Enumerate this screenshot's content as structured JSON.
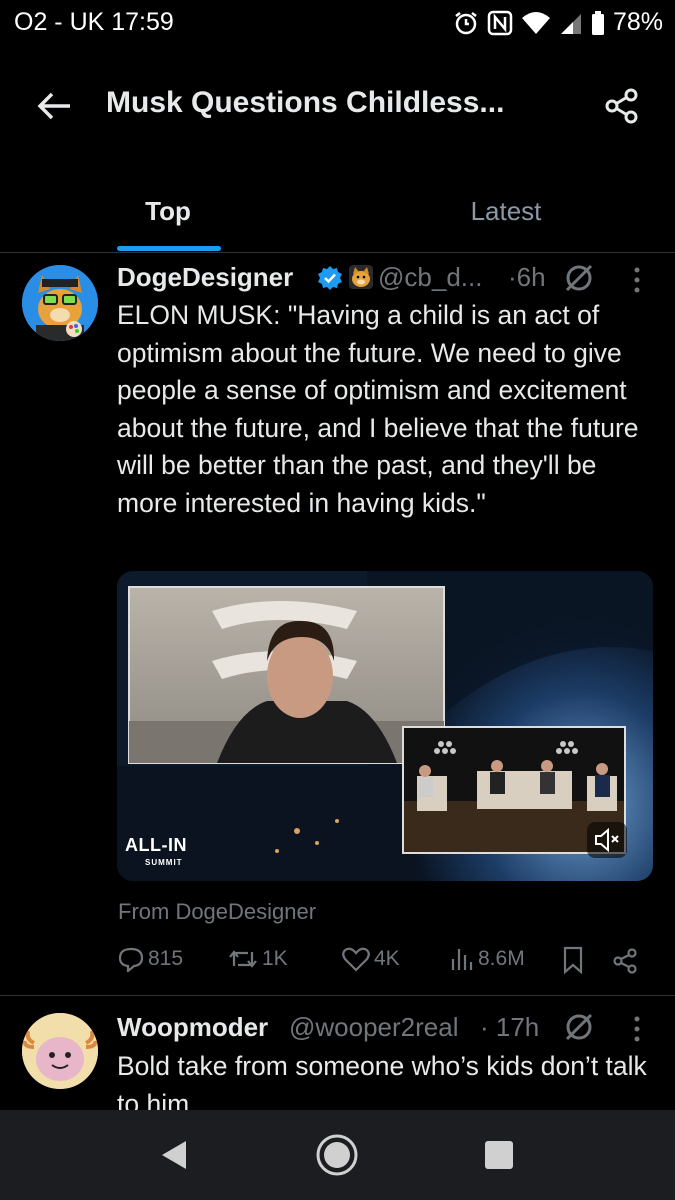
{
  "status_bar": {
    "carrier_time": "O2 - UK 17:59",
    "battery": "78%"
  },
  "header": {
    "title": "Musk Questions Childless...",
    "back_icon": "arrow-left-icon",
    "share_icon": "share-icon"
  },
  "tabs": [
    {
      "label": "Top",
      "active": true
    },
    {
      "label": "Latest",
      "active": false
    }
  ],
  "tweets": [
    {
      "display_name": "DogeDesigner",
      "handle": "@cb_d...",
      "time": "·6h",
      "text": "ELON MUSK: \"Having a child is an act of optimism about the future. We need to give people a sense of optimism and excitement about the future, and I believe that the future will be better than the past, and they'll be more interested in having kids.\"",
      "media": {
        "overlay_title": "ALL-IN",
        "overlay_subtitle": "SUMMIT"
      },
      "from_label": "From DogeDesigner",
      "stats": {
        "replies": "815",
        "reposts": "1K",
        "likes": "4K",
        "views": "8.6M"
      }
    },
    {
      "display_name": "Woopmoder",
      "handle": "@wooper2real",
      "time": "· 17h",
      "text": "Bold take from someone who’s kids don’t talk to him"
    }
  ],
  "colors": {
    "accent": "#1d9bf0",
    "background": "#000000",
    "muted": "#71767b"
  }
}
